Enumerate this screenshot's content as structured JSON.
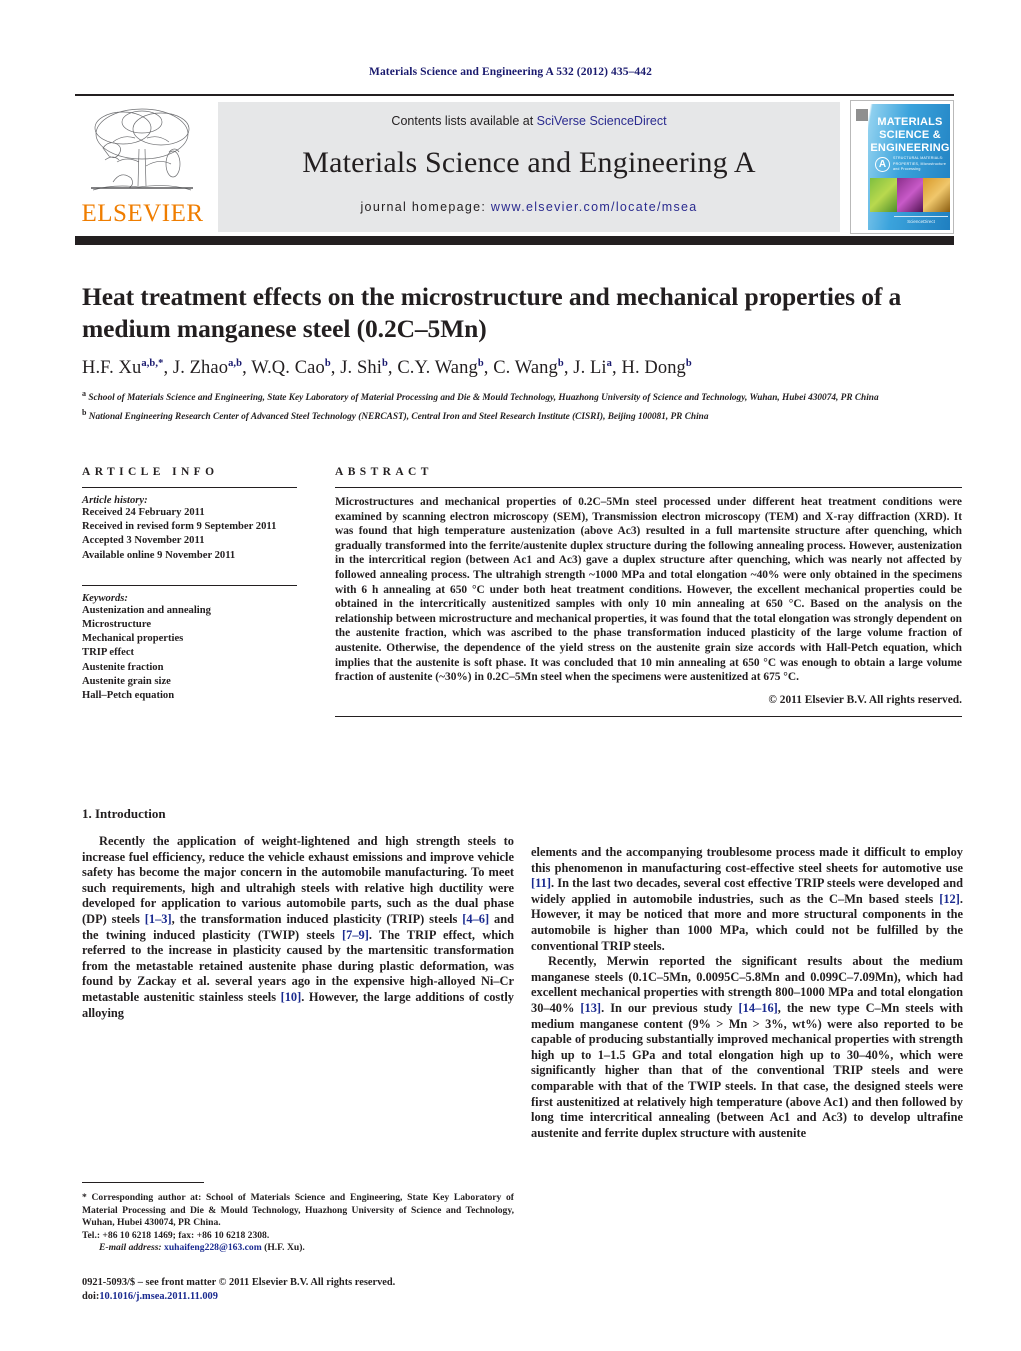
{
  "running_head": "Materials Science and Engineering A 532 (2012) 435–442",
  "masthead": {
    "contents_prefix": "Contents lists available at ",
    "contents_link": "SciVerse ScienceDirect",
    "journal_name": "Materials Science and Engineering A",
    "homepage_prefix": "journal homepage: ",
    "homepage_link": "www.elsevier.com/locate/msea",
    "publisher_logo_text": "ELSEVIER",
    "publisher_logo_icon": "elsevier-tree-icon",
    "cover": {
      "line1": "MATERIALS",
      "line2": "SCIENCE &",
      "line3": "ENGINEERING",
      "badge": "A",
      "subtitle": "STRUCTURAL MATERIALS: PROPERTIES, Microstructure and Processing",
      "footer": "ScienceDirect"
    },
    "link_color": "#2b2b8f"
  },
  "article": {
    "title": "Heat treatment effects on the microstructure and mechanical properties of a medium manganese steel (0.2C–5Mn)",
    "authors_html": "H.F. Xu<sup>a,b,*</sup>, J. Zhao<sup>a,b</sup>, W.Q. Cao<sup>b</sup>, J. Shi<sup>b</sup>, C.Y. Wang<sup>b</sup>, C. Wang<sup>b</sup>, J. Li<sup>a</sup>, H. Dong<sup>b</sup>",
    "affiliation_a": "School of Materials Science and Engineering, State Key Laboratory of Material Processing and Die & Mould Technology, Huazhong University of Science and Technology, Wuhan, Hubei 430074, PR China",
    "affiliation_b": "National Engineering Research Center of Advanced Steel Technology (NERCAST), Central Iron and Steel Research Institute (CISRI), Beijing 100081, PR China"
  },
  "article_info": {
    "section_label": "ARTICLE INFO",
    "history_label": "Article history:",
    "history": [
      "Received 24 February 2011",
      "Received in revised form 9 September 2011",
      "Accepted 3 November 2011",
      "Available online 9 November 2011"
    ],
    "keywords_label": "Keywords:",
    "keywords": [
      "Austenization and annealing",
      "Microstructure",
      "Mechanical properties",
      "TRIP effect",
      "Austenite fraction",
      "Austenite grain size",
      "Hall–Petch equation"
    ]
  },
  "abstract": {
    "section_label": "ABSTRACT",
    "text": "Microstructures and mechanical properties of 0.2C–5Mn steel processed under different heat treatment conditions were examined by scanning electron microscopy (SEM), Transmission electron microscopy (TEM) and X-ray diffraction (XRD). It was found that high temperature austenization (above Ac3) resulted in a full martensite structure after quenching, which gradually transformed into the ferrite/austenite duplex structure during the following annealing process. However, austenization in the intercritical region (between Ac1 and Ac3) gave a duplex structure after quenching, which was nearly not affected by followed annealing process. The ultrahigh strength ~1000 MPa and total elongation ~40% were only obtained in the specimens with 6 h annealing at 650 °C under both heat treatment conditions. However, the excellent mechanical properties could be obtained in the intercritically austenitized samples with only 10 min annealing at 650 °C. Based on the analysis on the relationship between microstructure and mechanical properties, it was found that the total elongation was strongly dependent on the austenite fraction, which was ascribed to the phase transformation induced plasticity of the large volume fraction of austenite. Otherwise, the dependence of the yield stress on the austenite grain size accords with Hall-Petch equation, which implies that the austenite is soft phase. It was concluded that 10 min annealing at 650 °C was enough to obtain a large volume fraction of austenite (~30%) in 0.2C–5Mn steel when the specimens were austenitized at 675 °C.",
    "copyright": "© 2011 Elsevier B.V. All rights reserved."
  },
  "introduction": {
    "heading": "1.  Introduction",
    "left_para_1_a": "Recently the application of weight-lightened and high strength steels to increase fuel efficiency, reduce the vehicle exhaust emissions and improve vehicle safety has become the major concern in the automobile manufacturing. To meet such requirements, high and ultrahigh steels with relative high ductility were developed for application to various automobile parts, such as the dual phase (DP) steels ",
    "ref_1_3": "[1–3]",
    "left_para_1_b": ", the transformation induced plasticity (TRIP) steels ",
    "ref_4_6": "[4–6]",
    "left_para_1_c": " and the twining induced plasticity (TWIP) steels ",
    "ref_7_9": "[7–9]",
    "left_para_1_d": ". The TRIP effect, which referred to the increase in plasticity caused by the martensitic transformation from the metastable retained austenite phase during plastic deformation, was found by Zackay et al. several years ago in the expensive high-alloyed Ni–Cr metastable austenitic stainless steels ",
    "ref_10": "[10]",
    "left_para_1_e": ". However, the large additions of costly alloying",
    "right_para_1_a": "elements and the accompanying troublesome process made it difficult to employ this phenomenon in manufacturing cost-effective steel sheets for automotive use ",
    "ref_11": "[11]",
    "right_para_1_b": ". In the last two decades, several cost effective TRIP steels were developed and widely applied in automobile industries, such as the C–Mn based steels ",
    "ref_12": "[12]",
    "right_para_1_c": ". However, it may be noticed that more and more structural components in the automobile is higher than 1000 MPa, which could not be fulfilled by the conventional TRIP steels.",
    "right_para_2_a": "Recently, Merwin reported the significant results about the medium manganese steels (0.1C–5Mn, 0.0095C–5.8Mn and 0.099C–7.09Mn), which had excellent mechanical properties with strength 800–1000 MPa and total elongation 30–40% ",
    "ref_13": "[13]",
    "right_para_2_b": ". In our previous study ",
    "ref_14_16": "[14–16]",
    "right_para_2_c": ", the new type C–Mn steels with medium manganese content (9% > Mn > 3%, wt%) were also reported to be capable of producing substantially improved mechanical properties with strength high up to 1–1.5 GPa and total elongation high up to 30–40%, which were significantly higher than that of the conventional TRIP steels and were comparable with that of the TWIP steels. In that case, the designed steels were first austenitized at relatively high temperature (above Ac1) and then followed by long time intercritical annealing (between Ac1 and Ac3) to develop ultrafine austenite and ferrite duplex structure with austenite"
  },
  "footnote": {
    "corresponding": "* Corresponding author at: School of Materials Science and Engineering, State Key Laboratory of Material Processing and Die & Mould Technology, Huazhong University of Science and Technology, Wuhan, Hubei 430074, PR China.",
    "tel": "Tel.: +86 10 6218 1469; fax: +86 10 6218 2308.",
    "email_label": "E-mail address:",
    "email": "xuhaifeng228@163.com",
    "email_owner": "(H.F. Xu)."
  },
  "frontmatter": {
    "line1": "0921-5093/$ – see front matter © 2011 Elsevier B.V. All rights reserved.",
    "doi_label": "doi:",
    "doi": "10.1016/j.msea.2011.11.009"
  }
}
